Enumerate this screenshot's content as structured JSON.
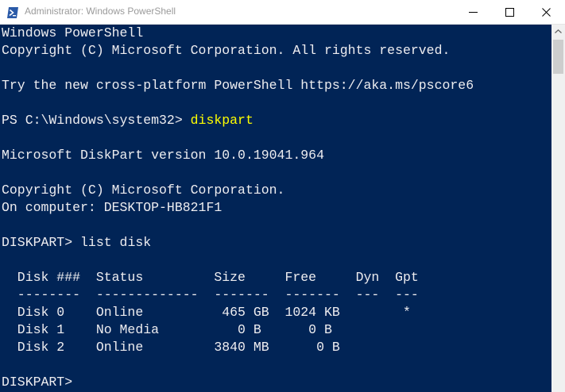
{
  "window": {
    "title": "Administrator: Windows PowerShell",
    "icons": {
      "app": "powershell-icon",
      "minimize": "minimize-icon",
      "maximize": "maximize-icon",
      "close": "close-icon",
      "scroll_up": "chevron-up-icon"
    }
  },
  "console": {
    "banner": "Windows PowerShell",
    "copyright": "Copyright (C) Microsoft Corporation. All rights reserved.",
    "blank1": "",
    "tip": "Try the new cross-platform PowerShell https://aka.ms/pscore6",
    "blank2": "",
    "prompt1": "PS C:\\Windows\\system32> ",
    "command1": "diskpart",
    "blank3": "",
    "diskpart_version": "Microsoft DiskPart version 10.0.19041.964",
    "blank4": "",
    "diskpart_copyright": "Copyright (C) Microsoft Corporation.",
    "computer": "On computer: DESKTOP-HB821F1",
    "blank5": "",
    "prompt2": "DISKPART> ",
    "command2": "list disk",
    "blank6": "",
    "table_header": "  Disk ###  Status         Size     Free     Dyn  Gpt",
    "table_rule": "  --------  -------------  -------  -------  ---  ---",
    "rows": [
      "  Disk 0    Online          465 GB  1024 KB        *",
      "  Disk 1    No Media          0 B      0 B",
      "  Disk 2    Online         3840 MB      0 B"
    ],
    "blank7": "",
    "prompt3": "DISKPART> "
  },
  "colors": {
    "console_bg": "#012456",
    "console_fg": "#eeedf0",
    "command": "#ffff00",
    "titlebar_bg": "#ffffff",
    "title_text": "#9a9a9a"
  }
}
